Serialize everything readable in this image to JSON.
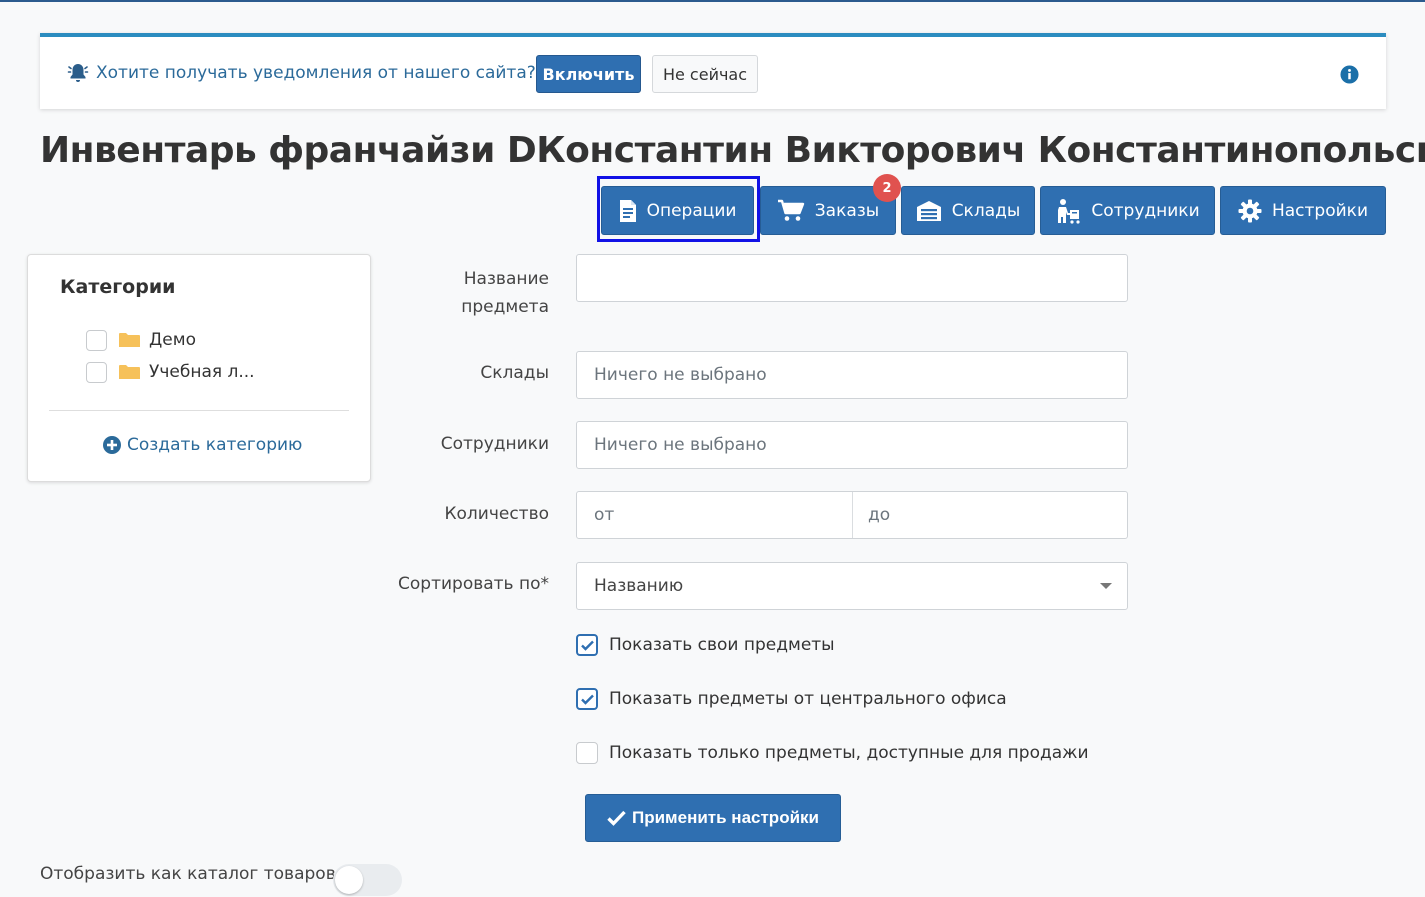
{
  "notification": {
    "message": "Хотите получать уведомления от нашего сайта?",
    "enable_label": "Включить",
    "later_label": "Не сейчас"
  },
  "page_title": "Инвентарь франчайзи DКонстантин Викторович Константинопольский",
  "toolbar": {
    "operations": "Операции",
    "orders": "Заказы",
    "orders_badge": "2",
    "warehouses": "Склады",
    "employees": "Сотрудники",
    "settings": "Настройки"
  },
  "categories": {
    "title": "Категории",
    "items": [
      {
        "label": "Демо"
      },
      {
        "label": "Учебная л..."
      }
    ],
    "create_label": "Создать категорию"
  },
  "filters": {
    "item_name_label_line1": "Название",
    "item_name_label_line2": "предмета",
    "item_name_value": "",
    "warehouses_label": "Склады",
    "warehouses_placeholder": "Ничего не выбрано",
    "employees_label": "Сотрудники",
    "employees_placeholder": "Ничего не выбрано",
    "quantity_label": "Количество",
    "quantity_from_placeholder": "от",
    "quantity_to_placeholder": "до",
    "sort_label": "Сортировать по*",
    "sort_value": "Названию",
    "checkboxes": [
      {
        "label": "Показать свои предметы",
        "checked": true
      },
      {
        "label": "Показать предметы от центрального офиса",
        "checked": true
      },
      {
        "label": "Показать только предметы, доступные для продажи",
        "checked": false
      }
    ],
    "apply_label": "Применить настройки"
  },
  "catalog_toggle": {
    "label": "Отобразить как каталог товаров",
    "on": false
  },
  "colors": {
    "primary": "#2f6fb1",
    "link": "#2b6a9a",
    "badge": "#e0524f",
    "focus": "#1212e6"
  }
}
